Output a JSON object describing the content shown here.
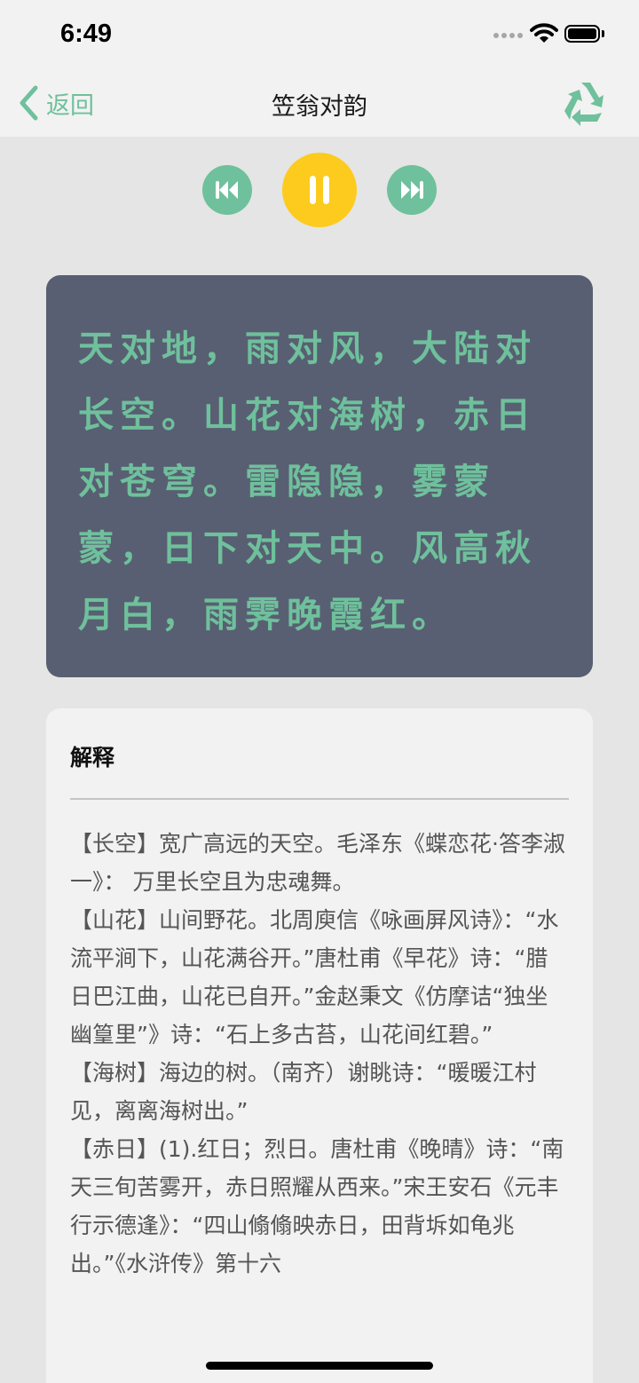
{
  "status_bar": {
    "time": "6:49"
  },
  "nav": {
    "back_label": "返回",
    "title": "笠翁对韵",
    "accent_color": "#6fc09c"
  },
  "player": {
    "prev_icon": "rewind-icon",
    "pause_icon": "pause-icon",
    "next_icon": "fast-forward-icon",
    "pause_color": "#fccb1d"
  },
  "poem": {
    "lines": [
      "天对地，雨对风，大陆对",
      "长空。山花对海树，赤日",
      "对苍穹。雷隐隐，雾蒙",
      "蒙，日下对天中。风高秋",
      "月白，雨霁晚霞红。"
    ]
  },
  "explanation": {
    "title": "解释",
    "paragraphs": [
      "【长空】宽广高远的天空。毛泽东《蝶恋花·答李淑一》： 万里长空且为忠魂舞。",
      "【山花】山间野花。北周庾信《咏画屏风诗》：“水流平涧下，山花满谷开。”唐杜甫《早花》诗：“腊日巴江曲，山花已自开。”金赵秉文《仿摩诘“独坐幽篁里”》诗：“石上多古苔，山花间红碧。”",
      "【海树】海边的树。（南齐）谢眺诗：“暖暖江村见，离离海树出。”",
      "【赤日】(1).红日；烈日。唐杜甫《晚晴》诗：“南天三旬苦雾开，赤日照耀从西来。”宋王安石《元丰行示德逢》：“四山翛翛映赤日，田背坼如龟兆出。”《水浒传》第十六"
    ]
  }
}
